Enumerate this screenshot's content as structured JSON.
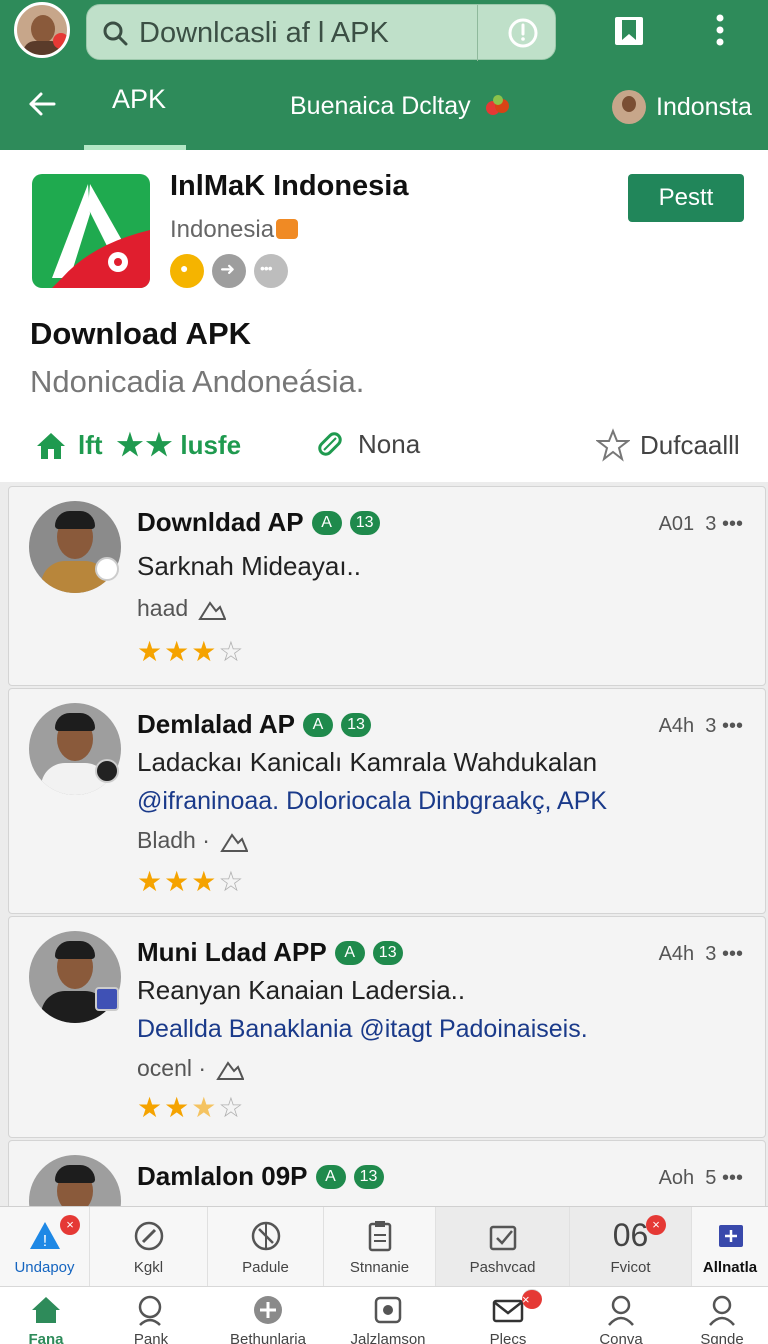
{
  "search": {
    "text": "Downlcasli  af l APK"
  },
  "tabs": {
    "apk": "APK",
    "middle": "Buenaica Dcltay",
    "right": "Indonsta"
  },
  "app": {
    "name": "InlMaK Indonesia",
    "country": "Indonesia",
    "button": "Pestt",
    "download_title": "Download APK",
    "download_subtitle": "Ndonicadia Andoneásia.",
    "stat_home": "lft",
    "stat_rating_text": "lusfe",
    "stat_nona": "Nona",
    "stat_download": "Dufcaalll"
  },
  "colors": {
    "brand": "#2e8b5a",
    "button": "#21865a",
    "link": "#1a3a8a",
    "star": "#f5a300",
    "badge": "#e53935"
  },
  "reviews": [
    {
      "title": "Downldad AP",
      "pill1": "A",
      "pill2": "13",
      "time": "A01",
      "count": "3",
      "line1": "Sarknah Mideayaı..",
      "line2": "",
      "meta": "haad",
      "rating": 3
    },
    {
      "title": "Demlalad AP",
      "pill1": "A",
      "pill2": "13",
      "time": "A4h",
      "count": "3",
      "line1": "Ladackaı Kanicalı Kamrala Wahdukalan",
      "line2": "@ifraninoaa. Doloriocala Dinbgraakç, APK",
      "meta": "Bladh ·",
      "rating": 3
    },
    {
      "title": "Muni Ldad APP",
      "pill1": "A",
      "pill2": "13",
      "time": "A4h",
      "count": "3",
      "line1": "Reanyan Kanaian Ladersia..",
      "line2": "Deallda Banaklania @itagt Padoinaiseis.",
      "meta": "ocenl ·",
      "rating": 2.5
    },
    {
      "title": "Damlalon 09P",
      "pill1": "A",
      "pill2": "13",
      "time": "Aoh",
      "count": "5",
      "line1": "",
      "line2": "",
      "meta": "",
      "rating": 0
    }
  ],
  "nav1": [
    {
      "label": "Undapoy",
      "icon": "warning-icon",
      "badge": "×"
    },
    {
      "label": "Kgkl",
      "icon": "compass-icon",
      "badge": ""
    },
    {
      "label": "Padule",
      "icon": "globe-icon",
      "badge": ""
    },
    {
      "label": "Stnnanie",
      "icon": "clipboard-icon",
      "badge": ""
    },
    {
      "label": "Pashvcad",
      "icon": "checklist-icon",
      "badge": ""
    },
    {
      "label": "Fvicot",
      "big": "06",
      "badge": "×"
    },
    {
      "label": "Allnatla",
      "icon": "plus-box-icon",
      "badge": ""
    }
  ],
  "nav2": [
    {
      "label": "Fana",
      "icon": "home-icon"
    },
    {
      "label": "Pank",
      "icon": "search-icon"
    },
    {
      "label": "Bethunlaria",
      "icon": "plus-circle-icon"
    },
    {
      "label": "Jalzlamson",
      "icon": "gallery-icon"
    },
    {
      "label": "Plecs",
      "icon": "mail-icon",
      "badge": "×"
    },
    {
      "label": "Conva",
      "icon": "user-icon"
    },
    {
      "label": "Sgnde",
      "icon": "profile-icon"
    }
  ]
}
